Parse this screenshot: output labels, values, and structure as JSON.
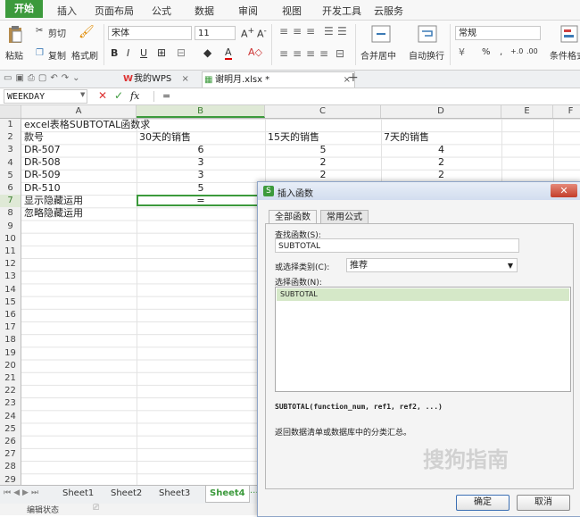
{
  "menu": {
    "tabs": [
      "开始",
      "插入",
      "页面布局",
      "公式",
      "数据",
      "审阅",
      "视图",
      "开发工具",
      "云服务"
    ]
  },
  "ribbon": {
    "paste": "粘贴",
    "cut": "剪切",
    "copy": "复制",
    "format_painter": "格式刷",
    "font_name": "宋体",
    "font_size": "11",
    "merge_center": "合并居中",
    "wrap_text": "自动换行",
    "number_format": "常规",
    "conditional_format": "条件格式",
    "pct": "%",
    "comma": ","
  },
  "doc_tabs": {
    "wps_label": "我的WPS",
    "file_label": "谢明月.xlsx *"
  },
  "formula_bar": {
    "name_box": "WEEKDAY",
    "fx": "fx",
    "content": "="
  },
  "columns": [
    "A",
    "B",
    "C",
    "D",
    "E",
    "F"
  ],
  "rows": [
    "1",
    "2",
    "3",
    "4",
    "5",
    "6",
    "7",
    "8",
    "9",
    "10",
    "11",
    "12",
    "13",
    "14",
    "15",
    "16",
    "17",
    "18",
    "19",
    "20",
    "21",
    "22",
    "23",
    "24",
    "25",
    "26",
    "27",
    "28",
    "29"
  ],
  "sheet": {
    "a1": "excel表格SUBTOTAL函数求",
    "headers": [
      "款号",
      "30天的销售",
      "15天的销售",
      "7天的销售"
    ],
    "data": [
      {
        "a": "DR-507",
        "b": "6",
        "c": "5",
        "d": "4"
      },
      {
        "a": "DR-508",
        "b": "3",
        "c": "2",
        "d": "2"
      },
      {
        "a": "DR-509",
        "b": "3",
        "c": "2",
        "d": "2"
      },
      {
        "a": "DR-510",
        "b": "5",
        "c": "",
        "d": ""
      }
    ],
    "a7": "显示隐藏运用",
    "b7": "=",
    "a8": "忽略隐藏运用"
  },
  "sheet_tabs": [
    "Sheet1",
    "Sheet2",
    "Sheet3",
    "Sheet4"
  ],
  "status": {
    "mode": "编辑状态"
  },
  "dialog": {
    "title": "插入函数",
    "tab_all": "全部函数",
    "tab_common": "常用公式",
    "search_label": "查找函数(S):",
    "search_value": "SUBTOTAL",
    "category_label": "或选择类别(C):",
    "category_value": "推荐",
    "select_label": "选择函数(N):",
    "functions": [
      "SUBTOTAL"
    ],
    "signature": "SUBTOTAL(function_num, ref1, ref2, ...)",
    "description": "返回数据清单或数据库中的分类汇总。",
    "ok": "确定",
    "cancel": "取消"
  },
  "watermark": "搜狗指南",
  "colors": {
    "accent": "#3c9a3c",
    "dialog_border": "#8fa5c7",
    "selection": "#dfe9d6"
  }
}
